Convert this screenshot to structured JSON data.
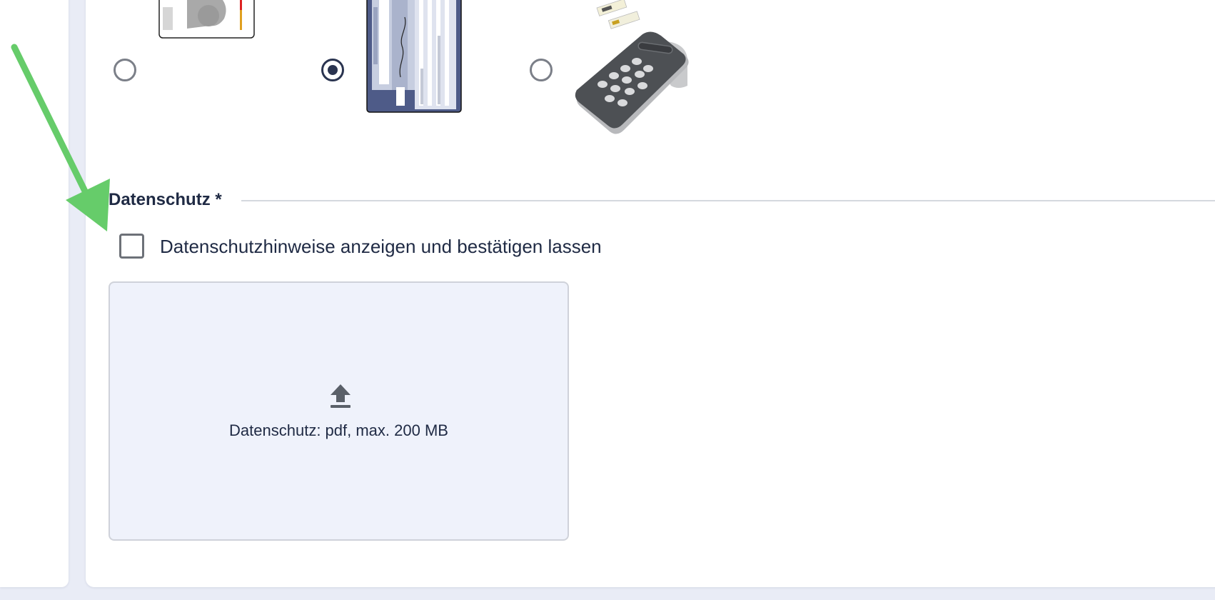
{
  "identity_methods": {
    "options": [
      {
        "name": "id-card",
        "checked": false
      },
      {
        "name": "health-insurance-card",
        "checked": true
      },
      {
        "name": "card-reader",
        "checked": false
      }
    ]
  },
  "privacy": {
    "legend": "Datenschutz *",
    "checkbox_label": "Datenschutzhinweise anzeigen und bestätigen lassen",
    "checkbox_checked": false,
    "upload_text": "Datenschutz: pdf, max. 200 MB",
    "upload_icon": "upload-icon"
  },
  "colors": {
    "annotation_arrow": "#66cc6a",
    "dropzone_background": "#eff2fb",
    "text": "#1f2a44"
  }
}
